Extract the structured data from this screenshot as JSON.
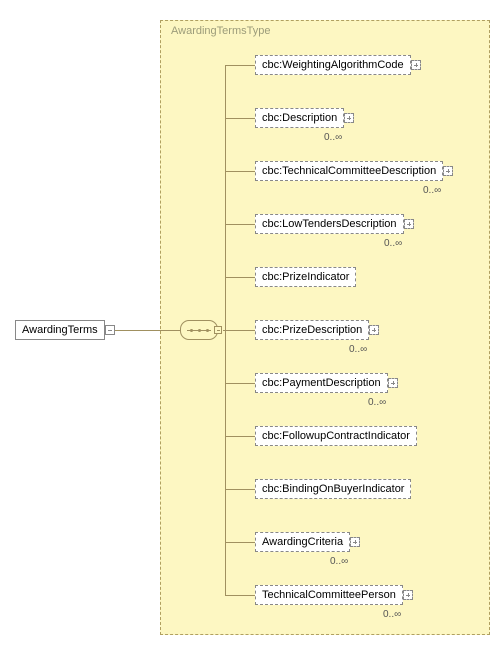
{
  "root": {
    "label": "AwardingTerms"
  },
  "type_group": {
    "title": "AwardingTermsType"
  },
  "children": [
    {
      "label": "cbc:WeightingAlgorithmCode",
      "optional": true,
      "repeat": false,
      "expand": true,
      "card": null
    },
    {
      "label": "cbc:Description",
      "optional": true,
      "repeat": true,
      "expand": true,
      "card": "0..∞"
    },
    {
      "label": "cbc:TechnicalCommitteeDescription",
      "optional": true,
      "repeat": true,
      "expand": true,
      "card": "0..∞"
    },
    {
      "label": "cbc:LowTendersDescription",
      "optional": true,
      "repeat": true,
      "expand": true,
      "card": "0..∞"
    },
    {
      "label": "cbc:PrizeIndicator",
      "optional": true,
      "repeat": false,
      "expand": false,
      "card": null
    },
    {
      "label": "cbc:PrizeDescription",
      "optional": true,
      "repeat": true,
      "expand": true,
      "card": "0..∞"
    },
    {
      "label": "cbc:PaymentDescription",
      "optional": true,
      "repeat": true,
      "expand": true,
      "card": "0..∞"
    },
    {
      "label": "cbc:FollowupContractIndicator",
      "optional": true,
      "repeat": false,
      "expand": false,
      "card": null
    },
    {
      "label": "cbc:BindingOnBuyerIndicator",
      "optional": true,
      "repeat": false,
      "expand": false,
      "card": null
    },
    {
      "label": "AwardingCriteria",
      "optional": true,
      "repeat": true,
      "expand": true,
      "card": "0..∞"
    },
    {
      "label": "TechnicalCommitteePerson",
      "optional": true,
      "repeat": true,
      "expand": true,
      "card": "0..∞"
    }
  ]
}
